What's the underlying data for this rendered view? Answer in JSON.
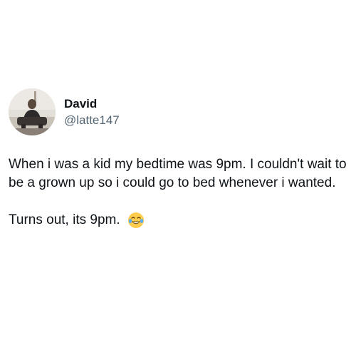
{
  "tweet": {
    "author": {
      "display_name": "David",
      "handle": "@latte147",
      "avatar_icon": "profile-photo"
    },
    "text_paragraph_1": "When i was a kid my bedtime was 9pm. I couldn't wait to be a grown up so i could go to bed whenever i wanted.",
    "text_paragraph_2": "Turns out, its 9pm.",
    "emoji_icon": "face-with-tears-of-joy-emoji"
  }
}
